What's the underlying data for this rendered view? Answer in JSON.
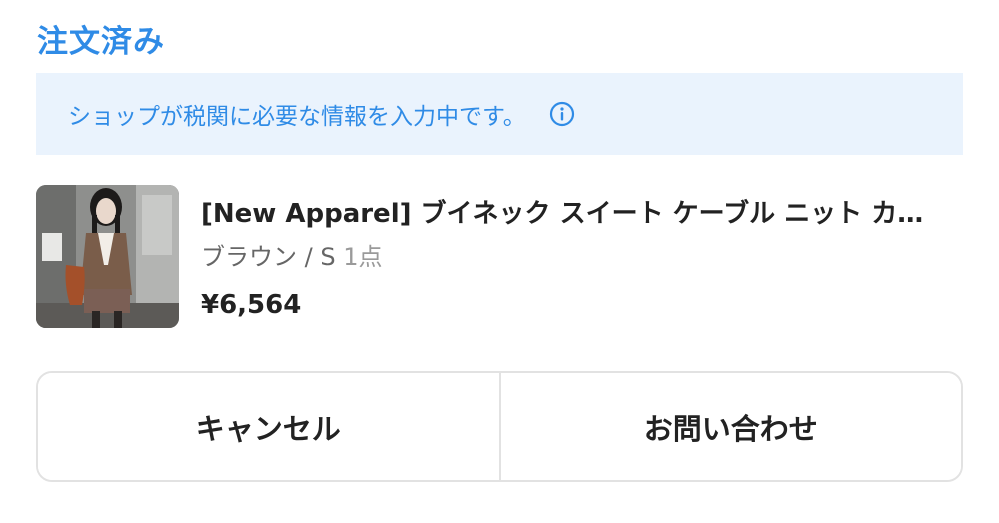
{
  "order": {
    "status_title": "注文済み"
  },
  "notice": {
    "text": "ショップが税関に必要な情報を入力中です。",
    "icon": "info-icon",
    "color": "#2f8be6",
    "background": "#eaf3fd"
  },
  "product": {
    "name": "[New Apparel] ブイネック スイート ケーブル ニット カーディガン",
    "variant": "ブラウン / S",
    "quantity": "1点",
    "price": "¥6,564"
  },
  "actions": {
    "cancel_label": "キャンセル",
    "contact_label": "お問い合わせ"
  }
}
